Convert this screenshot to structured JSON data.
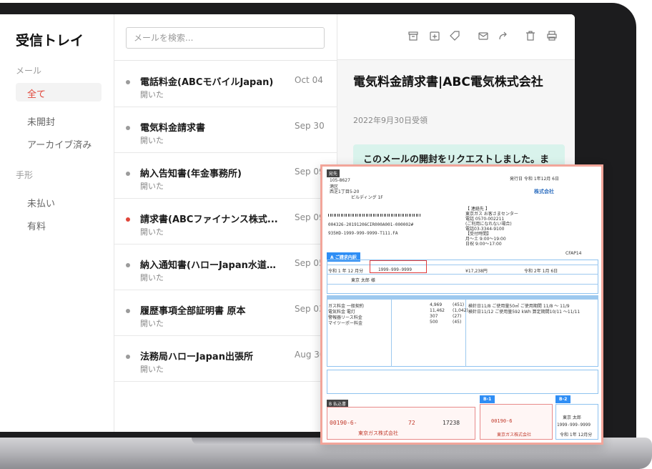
{
  "sidebar": {
    "title": "受信トレイ",
    "sections": [
      {
        "label": "メール",
        "items": [
          {
            "label": "全て",
            "active": true
          },
          {
            "label": "未開封"
          },
          {
            "label": "アーカイブ済み"
          }
        ]
      },
      {
        "label": "手形",
        "items": [
          {
            "label": "未払い"
          },
          {
            "label": "有料"
          }
        ]
      }
    ]
  },
  "search": {
    "placeholder": "メールを検索..."
  },
  "mails": [
    {
      "subject": "電話料金(ABCモバイルJapan)",
      "status": "開いた",
      "date": "Oct 04",
      "unread": false
    },
    {
      "subject": "電気料金請求書",
      "status": "開いた",
      "date": "Sep 30",
      "unread": false
    },
    {
      "subject": "納入告知書(年金事務所)",
      "status": "開いた",
      "date": "Sep 09",
      "unread": false
    },
    {
      "subject": "請求書(ABCファイナンス株式...",
      "status": "開いた",
      "date": "Sep 09",
      "unread": true
    },
    {
      "subject": "納入通知書(ハローJapan水道株...",
      "status": "開いた",
      "date": "Sep 05",
      "unread": false
    },
    {
      "subject": "履歴事項全部証明書 原本",
      "status": "開いた",
      "date": "Sep 03",
      "unread": false
    },
    {
      "subject": "法務局ハローJapan出張所",
      "status": "開いた",
      "date": "Aug 30",
      "unread": false
    }
  ],
  "toolbar": {
    "icons": [
      "archive-icon",
      "move-to-folder-icon",
      "tag-icon",
      "mark-unread-icon",
      "forward-icon",
      "delete-icon",
      "print-icon"
    ]
  },
  "detail": {
    "title": "電気料金請求書|ABC電気株式会社",
    "received": "2022年9月30日受領",
    "notice": "このメールの開封をリクエストしました。ま"
  },
  "invoice": {
    "addressee_tag": "宛先",
    "issue_date": "発行日 令和 1年12月 6日",
    "company": "株式会社",
    "postal": "105-8627",
    "district": "港区",
    "address": "西芝1丁目5-20",
    "building": "ビルディング 1F",
    "barcode_text": "004326-20191206CIR000A001-000002#",
    "code_line": "935HD-1999-999-9999-T111.FA",
    "contact_lines": [
      "【 連絡先 】",
      "東京ガス お客さまセンター",
      "電話 0570-002211",
      "(ご利用になれない場合)",
      "電話03-3344-9100",
      "【受付時間】",
      "月〜土 9:00〜19:00",
      "日祝 9:00〜17:00"
    ],
    "doc_code": "CFAP14",
    "section_a": "A ご請求内訳",
    "era": "令和 1 年 12 月分",
    "customer_no": "1999-999-9999",
    "amount": "¥17,238円",
    "due_date": "令和 2年 1月 6日",
    "customer_name": "東京 太郎 様",
    "line_items": [
      {
        "name": "ガス料金 一般契約",
        "amount": "4,969",
        "tax": "(451)",
        "note": "検針日11/8 ご使用量50㎥ ご使用期間 11/8 〜 11/9"
      },
      {
        "name": "電気料金 電灯",
        "amount": "11,462",
        "tax": "(1,042)",
        "note": "検針日11/12 ご使用量592 kWh 算定期間10/11 〜11/11"
      },
      {
        "name": "警報器リース料金",
        "amount": "307",
        "tax": "(27)",
        "note": ""
      },
      {
        "name": "マイツーポー料金",
        "amount": "500",
        "tax": "(45)",
        "note": ""
      }
    ],
    "section_b": "B 払込書",
    "b1": "B-1",
    "b2": "B-2",
    "payee": "東京ガス株式会社",
    "acct": "00190-6-",
    "acct_b1": "00190-6",
    "digits": "72",
    "total_digits": "17238",
    "b2_name": "東京 太郎",
    "b2_no": "1999-999-9999",
    "b2_era": "令和 1年 12月分"
  }
}
